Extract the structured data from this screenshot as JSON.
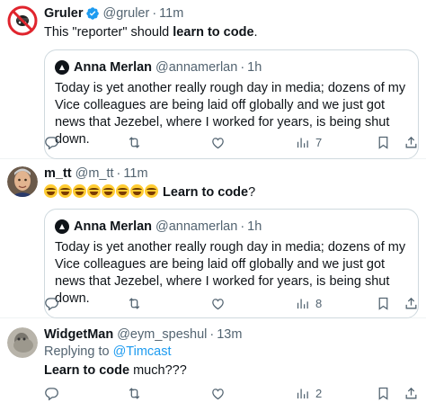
{
  "tweets": [
    {
      "name": "Gruler",
      "handle": "@gruler",
      "dot": "·",
      "time": "11m",
      "text_plain": "This \"reporter\" should ",
      "text_bold": "learn to code",
      "text_end": ".",
      "quote": {
        "name": "Anna Merlan",
        "handle": "@annamerlan",
        "dot": "·",
        "time": "1h",
        "text": "Today is yet another really rough day in media; dozens of my Vice colleagues are being laid off globally and we just got news that Jezebel, where I worked for years, is being shut down."
      },
      "views": "7"
    },
    {
      "name": "m_tt",
      "handle": "@m_tt",
      "dot": "·",
      "time": "11m",
      "emoji_count": 8,
      "emoji_name": "rolling-on-floor-laughing-emoji",
      "text_bold": "Learn to code",
      "text_end": "?",
      "quote": {
        "name": "Anna Merlan",
        "handle": "@annamerlan",
        "dot": "·",
        "time": "1h",
        "text": "Today is yet another really rough day in media; dozens of my Vice colleagues are being laid off globally and we just got news that Jezebel, where I worked for years, is being shut down."
      },
      "views": "8"
    },
    {
      "name": "WidgetMan",
      "handle": "@eym_speshul",
      "dot": "·",
      "time": "13m",
      "replying_to_label": "Replying to ",
      "replying_to_handle": "@Timcast",
      "text_bold": "Learn to code",
      "text_end": " much???",
      "views": "2"
    }
  ],
  "colors": {
    "text": "#0f1419",
    "muted": "#536471",
    "link": "#1d9bf0",
    "verified": "#1d9bf0",
    "border": "#cfd9de"
  },
  "icons": [
    "reply-icon",
    "retweet-icon",
    "like-icon",
    "views-icon",
    "bookmark-icon",
    "share-icon",
    "verified-badge-icon"
  ]
}
